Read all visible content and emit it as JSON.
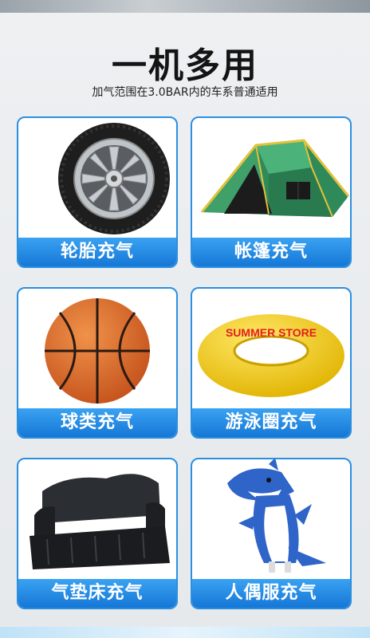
{
  "header": {
    "title": "一机多用",
    "subtitle": "加气范围在3.0BAR内的车系普通适用"
  },
  "cards": [
    {
      "label": "轮胎充气",
      "icon": "tire-icon"
    },
    {
      "label": "帐篷充气",
      "icon": "tent-icon"
    },
    {
      "label": "球类充气",
      "icon": "basketball-icon"
    },
    {
      "label": "游泳圈充气",
      "icon": "swim-ring-icon",
      "ring_text": "SUMMER STORE"
    },
    {
      "label": "气垫床充气",
      "icon": "air-mattress-icon"
    },
    {
      "label": "人偶服充气",
      "icon": "shark-costume-icon"
    }
  ],
  "colors": {
    "accent": "#2b8fe0",
    "label_top": "#3aa2f2",
    "label_bottom": "#1677d6"
  }
}
